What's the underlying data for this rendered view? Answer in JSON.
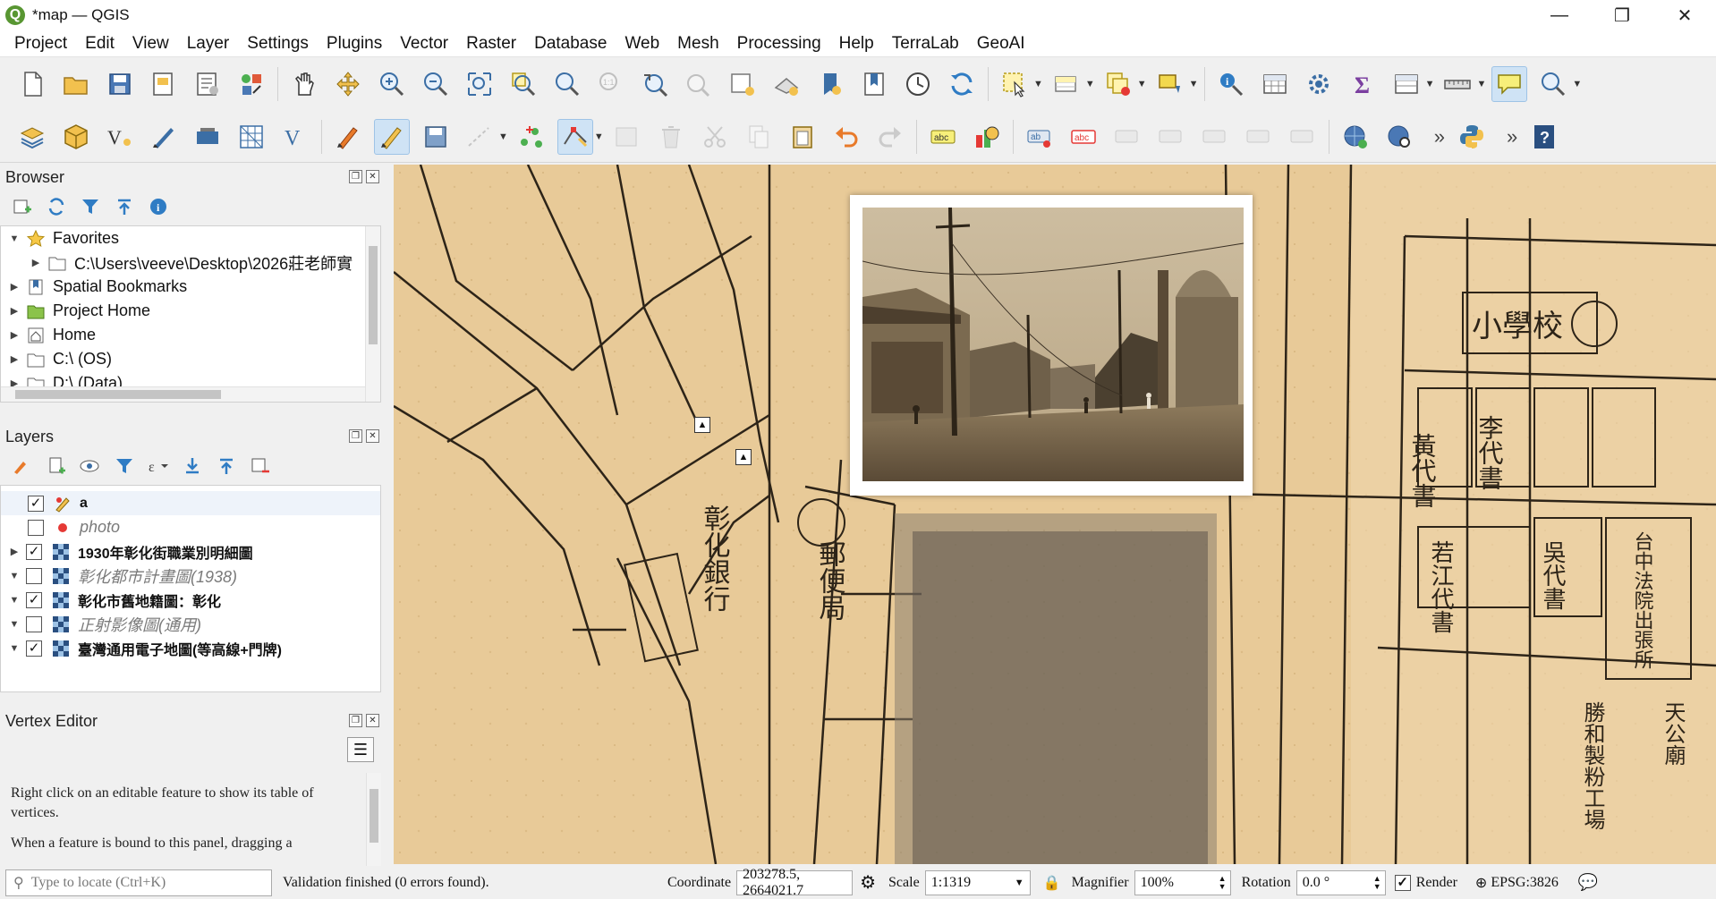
{
  "window": {
    "title": "*map — QGIS",
    "minimize": "—",
    "maximize": "❐",
    "close": "✕"
  },
  "menu": [
    "Project",
    "Edit",
    "View",
    "Layer",
    "Settings",
    "Plugins",
    "Vector",
    "Raster",
    "Database",
    "Web",
    "Mesh",
    "Processing",
    "Help",
    "TerraLab",
    "GeoAI"
  ],
  "browser": {
    "title": "Browser",
    "items": [
      {
        "label": "Favorites",
        "level": 0,
        "expanded": true,
        "icon": "star-icon"
      },
      {
        "label": "C:\\Users\\veeve\\Desktop\\2026莊老師實",
        "level": 1,
        "expanded": false,
        "icon": "folder-icon"
      },
      {
        "label": "Spatial Bookmarks",
        "level": 0,
        "expanded": false,
        "icon": "bookmark-icon"
      },
      {
        "label": "Project Home",
        "level": 0,
        "expanded": false,
        "icon": "project-home-icon"
      },
      {
        "label": "Home",
        "level": 0,
        "expanded": false,
        "icon": "home-icon"
      },
      {
        "label": "C:\\ (OS)",
        "level": 0,
        "expanded": false,
        "icon": "drive-icon"
      },
      {
        "label": "D:\\ (Data)",
        "level": 0,
        "expanded": false,
        "icon": "drive-icon"
      }
    ]
  },
  "layers": {
    "title": "Layers",
    "items": [
      {
        "label": "a",
        "checked": true,
        "style": "bold",
        "arrow": "",
        "icon": "edit-point-layer-icon"
      },
      {
        "label": "photo",
        "checked": false,
        "style": "grey",
        "arrow": "",
        "icon": "point-layer-icon"
      },
      {
        "label": "1930年彰化街職業別明細圖",
        "checked": true,
        "style": "bold",
        "arrow": "▶",
        "icon": "raster-layer-icon"
      },
      {
        "label": "彰化都市計畫圖(1938)",
        "checked": false,
        "style": "grey",
        "arrow": "▼",
        "icon": "raster-layer-icon"
      },
      {
        "label": "彰化市舊地籍圖：彰化",
        "checked": true,
        "style": "bold",
        "arrow": "▼",
        "icon": "raster-layer-icon"
      },
      {
        "label": "正射影像圖(通用)",
        "checked": false,
        "style": "grey",
        "arrow": "▼",
        "icon": "raster-layer-icon"
      },
      {
        "label": "臺灣通用電子地圖(等高線+門牌)",
        "checked": true,
        "style": "bold",
        "arrow": "▼",
        "icon": "raster-layer-icon"
      }
    ]
  },
  "vertex_editor": {
    "title": "Vertex Editor",
    "text1": "Right click on an editable feature to show its table of vertices.",
    "text2": "When a feature is bound to this panel, dragging a"
  },
  "status": {
    "locate_placeholder": "Type to locate (Ctrl+K)",
    "message": "Validation finished (0 errors found).",
    "coordinate_label": "Coordinate",
    "coordinate": "203278.5, 2664021.7",
    "scale_label": "Scale",
    "scale": "1:1319",
    "magnifier_label": "Magnifier",
    "magnifier": "100%",
    "rotation_label": "Rotation",
    "rotation": "0.0 °",
    "render_label": "Render",
    "crs": "EPSG:3826"
  },
  "map": {
    "labels": [
      {
        "text": "小學校",
        "icon": "school-symbol"
      },
      {
        "text": "彰化銀行"
      },
      {
        "text": "郵便局"
      },
      {
        "text": "黃代書"
      },
      {
        "text": "李代書"
      },
      {
        "text": "若江代書"
      },
      {
        "text": "吳代書"
      },
      {
        "text": "台中法院出張所"
      },
      {
        "text": "勝和製粉工場"
      },
      {
        "text": "天公廟"
      }
    ]
  },
  "colors": {
    "accent": "#589632",
    "map_paper": "#e6c898",
    "active_tool": "#cfe3f5"
  }
}
